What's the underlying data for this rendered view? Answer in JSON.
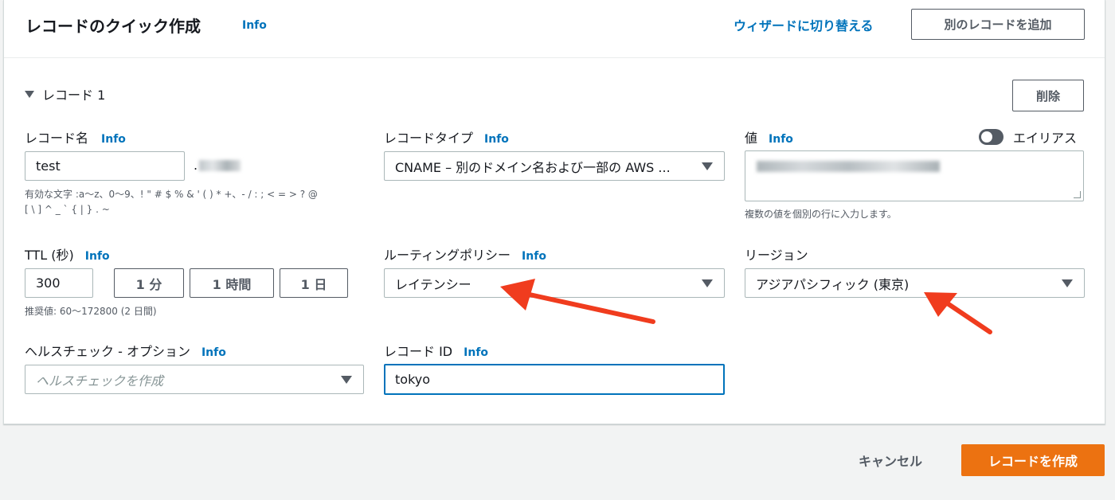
{
  "header": {
    "title": "レコードのクイック作成",
    "info": "Info",
    "switch_wizard": "ウィザードに切り替える",
    "add_record": "別のレコードを追加"
  },
  "record": {
    "section_label": "レコード 1",
    "delete": "削除",
    "name": {
      "label": "レコード名",
      "info": "Info",
      "value": "test",
      "domain_suffix": ".",
      "hint_line1": "有効な文字 :a〜z、0〜9、! \" # $ % & ' ( ) * +、- / : ; < = > ? @",
      "hint_line2": "[ \\ ] ^ _ ` { | } . ~"
    },
    "type": {
      "label": "レコードタイプ",
      "info": "Info",
      "value": "CNAME – 別のドメイン名および一部の AWS ..."
    },
    "value": {
      "label": "値",
      "info": "Info",
      "alias_label": "エイリアス",
      "alias_on": false,
      "hint": "複数の値を個別の行に入力します。"
    },
    "ttl": {
      "label": "TTL (秒)",
      "info": "Info",
      "value": "300",
      "presets": [
        "1 分",
        "1 時間",
        "1 日"
      ],
      "hint": "推奨値: 60〜172800 (2 日間)"
    },
    "routing": {
      "label": "ルーティングポリシー",
      "info": "Info",
      "value": "レイテンシー"
    },
    "region": {
      "label": "リージョン",
      "value": "アジアパシフィック (東京)"
    },
    "health": {
      "label": "ヘルスチェック - オプション",
      "info": "Info",
      "placeholder": "ヘルスチェックを作成"
    },
    "record_id": {
      "label": "レコード ID",
      "info": "Info",
      "value": "tokyo"
    }
  },
  "footer": {
    "cancel": "キャンセル",
    "create": "レコードを作成"
  },
  "colors": {
    "accent": "#0073bb",
    "primary_button": "#ec7211",
    "annotation_arrow": "#f03c1e"
  }
}
